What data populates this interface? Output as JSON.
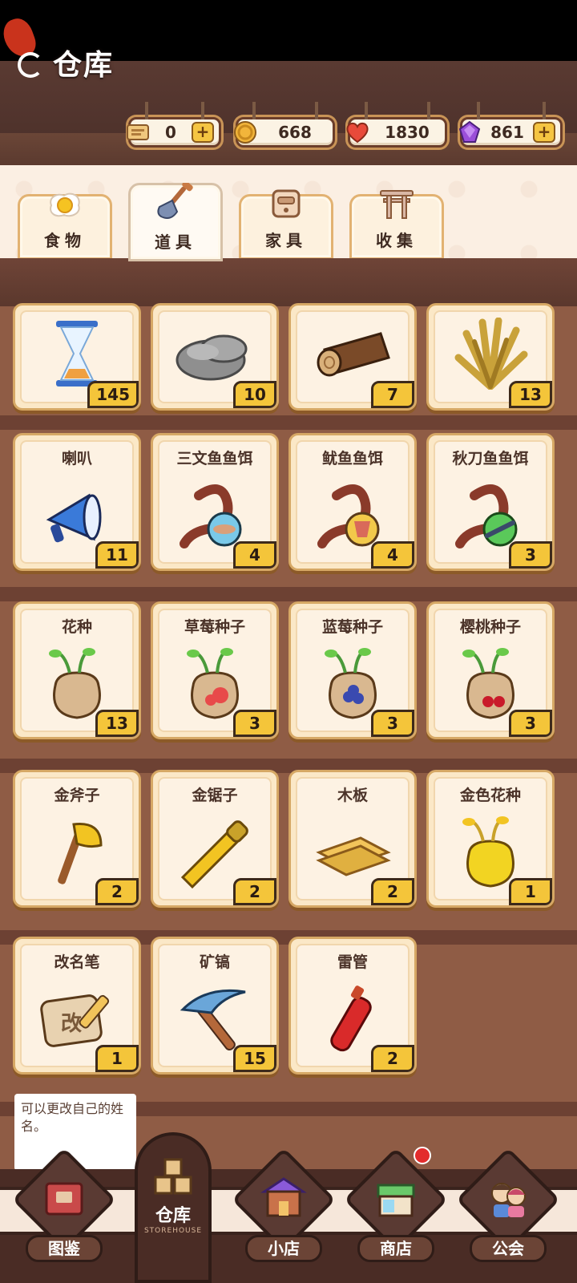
{
  "header": {
    "title": "仓库",
    "currencies": [
      {
        "name": "ticket",
        "value": "0",
        "icon": "ticket-icon",
        "has_plus": true
      },
      {
        "name": "coin",
        "value": "668",
        "icon": "coin-icon",
        "has_plus": false
      },
      {
        "name": "heart",
        "value": "1830",
        "icon": "heart-icon",
        "has_plus": false
      },
      {
        "name": "gem",
        "value": "861",
        "icon": "gem-icon",
        "has_plus": true
      }
    ],
    "plus_label": "+"
  },
  "tabs": [
    {
      "label": "食物",
      "icon": "egg-icon",
      "active": false
    },
    {
      "label": "道具",
      "icon": "shovel-icon",
      "active": true
    },
    {
      "label": "家具",
      "icon": "cabinet-icon",
      "active": false
    },
    {
      "label": "收集",
      "icon": "torii-icon",
      "active": false
    }
  ],
  "items_top_row": [
    {
      "icon": "hourglass-icon",
      "count": "145"
    },
    {
      "icon": "stone-icon",
      "count": "10"
    },
    {
      "icon": "log-icon",
      "count": "7"
    },
    {
      "icon": "straw-icon",
      "count": "13"
    }
  ],
  "items": [
    {
      "name": "喇叭",
      "icon": "megaphone-icon",
      "count": "11"
    },
    {
      "name": "三文鱼鱼饵",
      "icon": "salmon-bait-icon",
      "count": "4"
    },
    {
      "name": "鱿鱼鱼饵",
      "icon": "squid-bait-icon",
      "count": "4"
    },
    {
      "name": "秋刀鱼鱼饵",
      "icon": "saury-bait-icon",
      "count": "3"
    },
    {
      "name": "花种",
      "icon": "flower-seed-icon",
      "count": "13"
    },
    {
      "name": "草莓种子",
      "icon": "strawberry-seed-icon",
      "count": "3"
    },
    {
      "name": "蓝莓种子",
      "icon": "blueberry-seed-icon",
      "count": "3"
    },
    {
      "name": "樱桃种子",
      "icon": "cherry-seed-icon",
      "count": "3"
    },
    {
      "name": "金斧子",
      "icon": "golden-axe-icon",
      "count": "2"
    },
    {
      "name": "金锯子",
      "icon": "golden-saw-icon",
      "count": "2"
    },
    {
      "name": "木板",
      "icon": "planks-icon",
      "count": "2"
    },
    {
      "name": "金色花种",
      "icon": "golden-seed-icon",
      "count": "1"
    },
    {
      "name": "改名笔",
      "icon": "rename-pen-icon",
      "count": "1"
    },
    {
      "name": "矿镐",
      "icon": "pickaxe-icon",
      "count": "15"
    },
    {
      "name": "雷管",
      "icon": "dynamite-icon",
      "count": "2"
    }
  ],
  "tooltip": {
    "text": "可以更改自己的姓名。"
  },
  "nav": {
    "items": [
      {
        "label": "图鉴",
        "icon": "book-icon"
      },
      {
        "label": "仓库",
        "sub": "STOREHOUSE",
        "icon": "storehouse-icon",
        "active": true
      },
      {
        "label": "小店",
        "icon": "shop-building-icon"
      },
      {
        "label": "商店",
        "icon": "store-icon"
      },
      {
        "label": "公会",
        "icon": "guild-icon"
      }
    ]
  }
}
